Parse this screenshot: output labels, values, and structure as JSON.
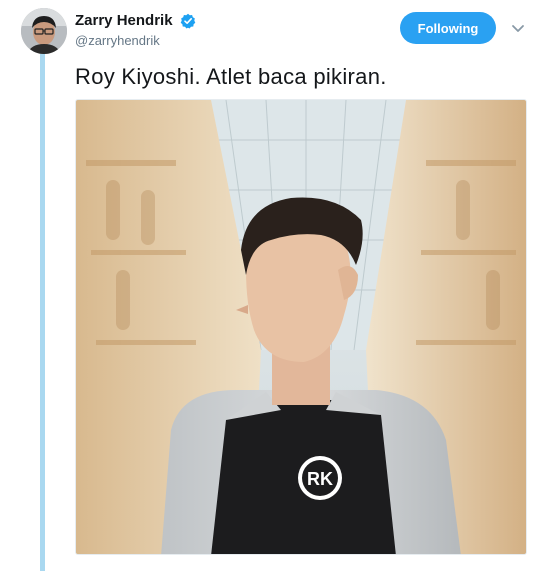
{
  "tweet": {
    "author": {
      "name": "Zarry Hendrik",
      "handle": "@zarryhendrik",
      "verified": true
    },
    "follow_label": "Following",
    "text": "Roy Kiyoshi. Atlet baca pikiran.",
    "photo_logo_text": "RK"
  },
  "colors": {
    "accent": "#2aa1f2",
    "thread_line": "#a9d8f0",
    "handle": "#657786"
  }
}
